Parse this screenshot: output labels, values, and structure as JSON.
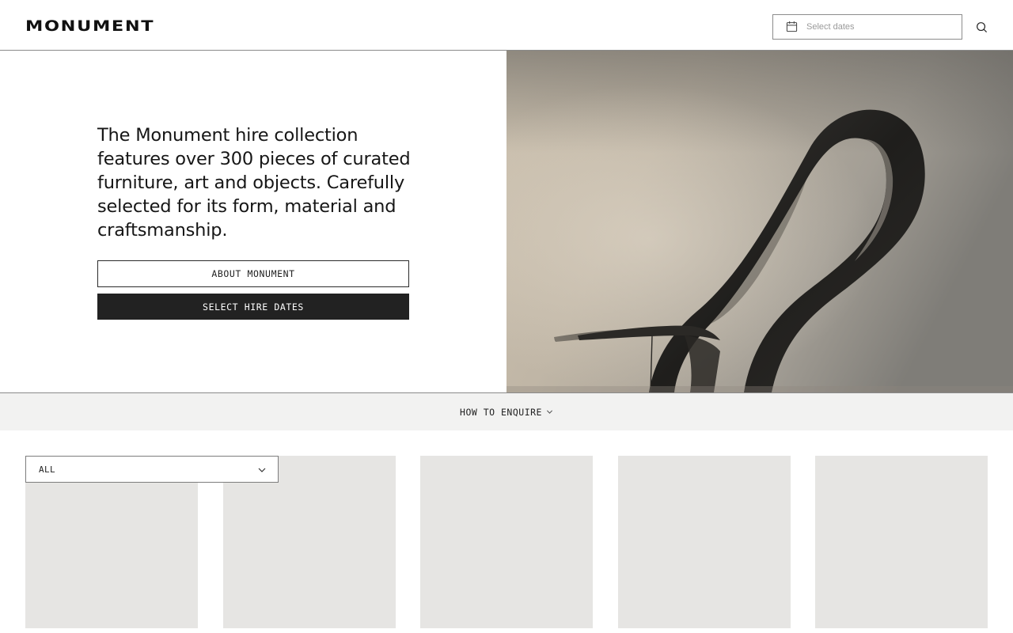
{
  "header": {
    "logo": "MONUMENT",
    "date_placeholder": "Select dates",
    "calendar_icon": "calendar-icon",
    "search_icon": "search-icon"
  },
  "hero": {
    "description": "The Monument hire collection features over 300 pieces of curated furniture, art and objects. Carefully selected for its form, material and craftsmanship.",
    "about_button": "ABOUT MONUMENT",
    "hire_button": "SELECT HIRE DATES",
    "image_alt": "Sculptural curved metal ribbon"
  },
  "enquire": {
    "label": "HOW TO ENQUIRE",
    "icon": "chevron-down-icon"
  },
  "filter": {
    "value": "ALL",
    "icon": "chevron-down-icon"
  },
  "products": [
    {
      "placeholder": true
    },
    {
      "placeholder": true
    },
    {
      "placeholder": true
    },
    {
      "placeholder": true
    },
    {
      "placeholder": true
    }
  ],
  "colors": {
    "text": "#1a1a1a",
    "button_dark": "#222222",
    "enquire_bg": "#f2f2f1",
    "card_placeholder": "#e6e5e3",
    "border": "#8a8a8a"
  }
}
